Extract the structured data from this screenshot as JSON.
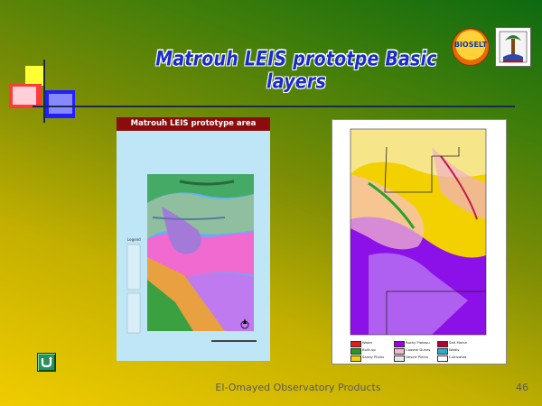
{
  "slide": {
    "title": "Matrouh LEIS prototpe Basic layers",
    "footer": "El-Omayed Observatory Products",
    "page_number": "46"
  },
  "logos": {
    "left_label": "BIOSELT",
    "left_icon": "bioselt-logo-icon",
    "right_icon": "university-logo-icon"
  },
  "left_map": {
    "header": "Matrouh LEIS prototype area",
    "legend_title": "Legend"
  },
  "right_map": {
    "legend": [
      {
        "label": "Water",
        "color": "#e02020"
      },
      {
        "label": "Built-up",
        "color": "#18a018"
      },
      {
        "label": "Sandy Plains",
        "color": "#f2d200"
      },
      {
        "label": "Rocky Plateau",
        "color": "#9a00e0"
      },
      {
        "label": "Coastal Dunes",
        "color": "#f5b8c8"
      },
      {
        "label": "Desert Plains",
        "color": "#e8e8e8"
      },
      {
        "label": "Salt Marsh",
        "color": "#b0003a"
      },
      {
        "label": "Wadis",
        "color": "#20b0d0"
      },
      {
        "label": "Cultivated",
        "color": "#ffffff"
      }
    ]
  },
  "colors": {
    "title": "#1a2cc8",
    "header_bar": "#8a0c0c",
    "nav_button": "#2a8f5a"
  },
  "nav": {
    "icon": "return-arrow-icon"
  }
}
